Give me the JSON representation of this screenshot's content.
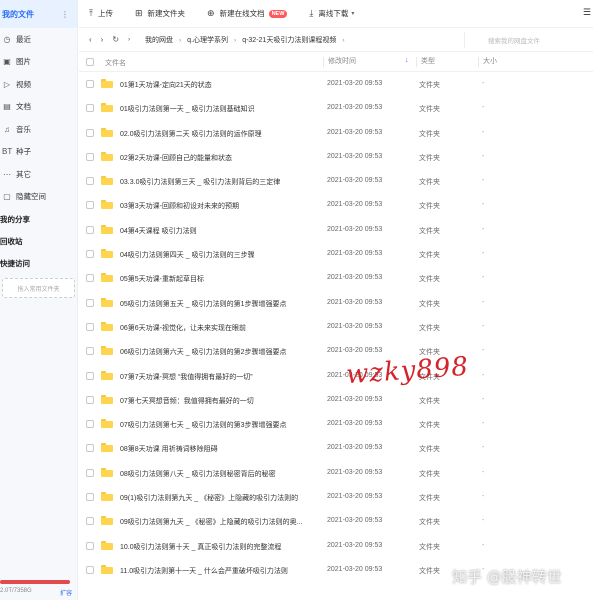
{
  "sidebar": {
    "all_files": "我的文件",
    "all_files_more": "⋮",
    "items": [
      {
        "icon": "clock-icon",
        "glyph": "◷",
        "label": "最近"
      },
      {
        "icon": "image-icon",
        "glyph": "▣",
        "label": "图片"
      },
      {
        "icon": "video-icon",
        "glyph": "▷",
        "label": "视频"
      },
      {
        "icon": "doc-icon",
        "glyph": "▤",
        "label": "文档"
      },
      {
        "icon": "music-icon",
        "glyph": "♫",
        "label": "音乐"
      },
      {
        "icon": "bt-icon",
        "glyph": "BT",
        "label": "种子"
      },
      {
        "icon": "more-icon",
        "glyph": "⋯",
        "label": "其它"
      },
      {
        "icon": "lock-icon",
        "glyph": "▢",
        "label": "隐藏空间"
      }
    ],
    "my_share": "我的分享",
    "recycle": "回收站",
    "quick_access": "快捷访问",
    "quick_access_placeholder": "拖入常用文件夹",
    "storage_text": "2.0T/7358G",
    "storage_used_fraction": 1.0,
    "expand": "扩容"
  },
  "toolbar": {
    "upload": "上传",
    "new_folder": "新建文件夹",
    "new_online_doc": "新建在线文档",
    "new_badge": "NEW",
    "offline_download": "离线下载",
    "view_toggle": "☰"
  },
  "nav": {
    "back": "‹",
    "forward": "›",
    "refresh": "↻",
    "breadcrumb": [
      "我的网盘",
      "q.心理学系列",
      "q-32-21天吸引力法则课程视频"
    ],
    "search_placeholder": "搜索我的网盘文件"
  },
  "table": {
    "headers": {
      "name": "文件名",
      "modified": "修改时间",
      "type": "类型",
      "size": "大小"
    },
    "sort_indicator": "↓",
    "rows": [
      {
        "name": "01第1天功课-定向21天的状态",
        "date": "2021-03-20 09:53",
        "type": "文件夹",
        "size": "-"
      },
      {
        "name": "01吸引力法则第一天 _ 吸引力法则基础知识",
        "date": "2021-03-20 09:53",
        "type": "文件夹",
        "size": "-"
      },
      {
        "name": "02.0吸引力法则第二天 吸引力法则的运作原理",
        "date": "2021-03-20 09:53",
        "type": "文件夹",
        "size": "-"
      },
      {
        "name": "02第2天功课-回顾自己的能量和状态",
        "date": "2021-03-20 09:53",
        "type": "文件夹",
        "size": "-"
      },
      {
        "name": "03.3.0吸引力法则第三天 _ 吸引力法则背后的三定律",
        "date": "2021-03-20 09:53",
        "type": "文件夹",
        "size": "-"
      },
      {
        "name": "03第3天功课-回顾和初设对未来的预期",
        "date": "2021-03-20 09:53",
        "type": "文件夹",
        "size": "-"
      },
      {
        "name": "04第4天课程 吸引力法则",
        "date": "2021-03-20 09:53",
        "type": "文件夹",
        "size": "-"
      },
      {
        "name": "04吸引力法则第四天 _ 吸引力法则的三步骤",
        "date": "2021-03-20 09:53",
        "type": "文件夹",
        "size": "-"
      },
      {
        "name": "05第5天功课-重新起草目标",
        "date": "2021-03-20 09:53",
        "type": "文件夹",
        "size": "-"
      },
      {
        "name": "05吸引力法则第五天 _ 吸引力法则的第1步骤增强要点",
        "date": "2021-03-20 09:53",
        "type": "文件夹",
        "size": "-"
      },
      {
        "name": "06第6天功课-视觉化，让未来实现在眼前",
        "date": "2021-03-20 09:53",
        "type": "文件夹",
        "size": "-"
      },
      {
        "name": "06吸引力法则第六天 _ 吸引力法则的第2步骤增强要点",
        "date": "2021-03-20 09:53",
        "type": "文件夹",
        "size": "-"
      },
      {
        "name": "07第7天功课-冥想 “我值得拥有最好的一切”",
        "date": "2021-03-20 09:53",
        "type": "文件夹",
        "size": "-"
      },
      {
        "name": "07第七天冥想音频：我值得拥有最好的一切",
        "date": "2021-03-20 09:53",
        "type": "文件夹",
        "size": "-"
      },
      {
        "name": "07吸引力法则第七天 _ 吸引力法则的第3步骤增强要点",
        "date": "2021-03-20 09:53",
        "type": "文件夹",
        "size": "-"
      },
      {
        "name": "08第8天功课 用祈祷词移除阻碍",
        "date": "2021-03-20 09:53",
        "type": "文件夹",
        "size": "-"
      },
      {
        "name": "08吸引力法则第八天 _ 吸引力法则秘密背后的秘密",
        "date": "2021-03-20 09:53",
        "type": "文件夹",
        "size": "-"
      },
      {
        "name": "09(1)吸引力法则第九天 _ 《秘密》上隐藏的吸引力法则的",
        "date": "2021-03-20 09:53",
        "type": "文件夹",
        "size": "-"
      },
      {
        "name": "09吸引力法则第九天 _ 《秘密》上隐藏的吸引力法则的奥...",
        "date": "2021-03-20 09:53",
        "type": "文件夹",
        "size": "-"
      },
      {
        "name": "10.0吸引力法则第十天 _ 真正吸引力法则的完整流程",
        "date": "2021-03-20 09:53",
        "type": "文件夹",
        "size": "-"
      },
      {
        "name": "11.0吸引力法则第十一天 _ 什么会严重破坏吸引力法则",
        "date": "2021-03-20 09:53",
        "type": "文件夹",
        "size": "-"
      }
    ]
  },
  "overlay": {
    "handwriting": "wzky898",
    "watermark": "知乎 @股神转世"
  }
}
